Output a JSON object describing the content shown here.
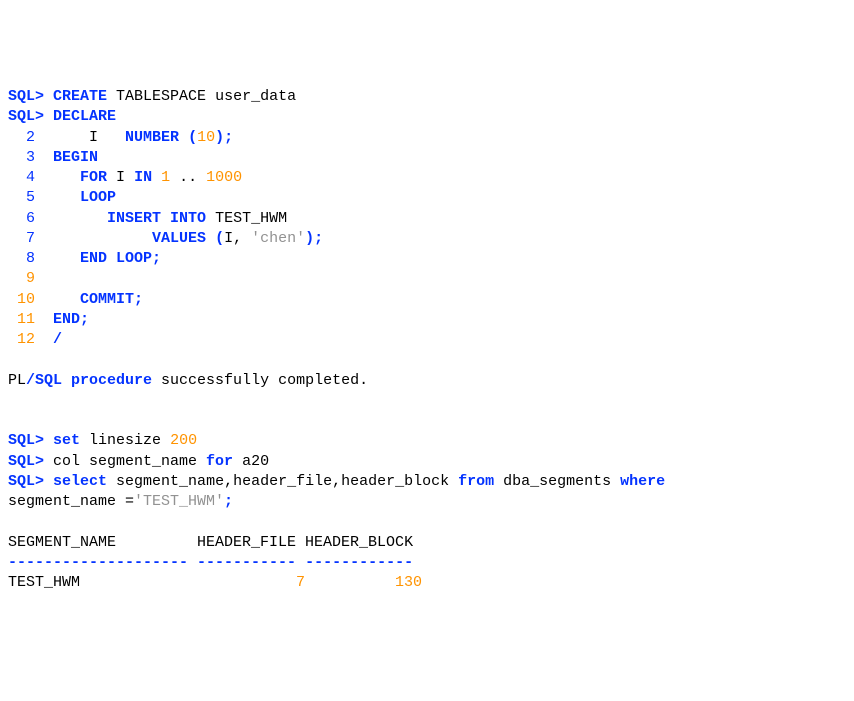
{
  "prompt": "SQL>",
  "lines": {
    "l0a": "CREATE",
    "l0b": " TABLESPACE user_data",
    "l1": "DECLARE",
    "l2a": "    I   ",
    "l2b": "NUMBER",
    "l2c": "(",
    "l2d": "10",
    "l2e": ");",
    "l3": "BEGIN",
    "l4a": "   ",
    "l4b": "FOR",
    "l4c": " I ",
    "l4d": "IN",
    "l4e": " ",
    "l4f": "1",
    "l4g": " .. ",
    "l4h": "1000",
    "l5": "LOOP",
    "l6a": "INSERT",
    "l6b": "INTO",
    "l6c": " TEST_HWM",
    "l7a": "VALUES",
    "l7b": "(",
    "l7c": "I, ",
    "l7d": "'chen'",
    "l7e": ");",
    "l8a": "END",
    "l8b": "LOOP;",
    "l10": "COMMIT;",
    "l11": "END;",
    "l12": "/"
  },
  "line_numbers": {
    "n2": "2",
    "n3": "3",
    "n4": "4",
    "n5": "5",
    "n6": "6",
    "n7": "7",
    "n8": "8",
    "n9": "9",
    "n10": "10",
    "n11": "11",
    "n12": "12"
  },
  "msg_a": "PL",
  "msg_b": "/SQL procedure",
  "msg_c": " successfully completed.",
  "set": {
    "kw": "set",
    "rest": " linesize ",
    "num": "200"
  },
  "col": {
    "a": " col segment_name ",
    "b": "for",
    "c": " a20"
  },
  "select": {
    "kw1": "select",
    "mid": " segment_name,header_file,header_block ",
    "kw2": "from",
    "mid2": " dba_segments ",
    "kw3": "where"
  },
  "where": {
    "a": "segment_name =",
    "b": "'TEST_HWM'",
    "c": ";"
  },
  "headers": {
    "c1": "SEGMENT_NAME",
    "c2": "HEADER_FILE",
    "c3": "HEADER_BLOCK"
  },
  "sep": {
    "c1": "--------------------",
    "c2": "-----------",
    "c3": "------------"
  },
  "rowdata": {
    "c1": "TEST_HWM",
    "c2": "7",
    "c3": "130"
  }
}
